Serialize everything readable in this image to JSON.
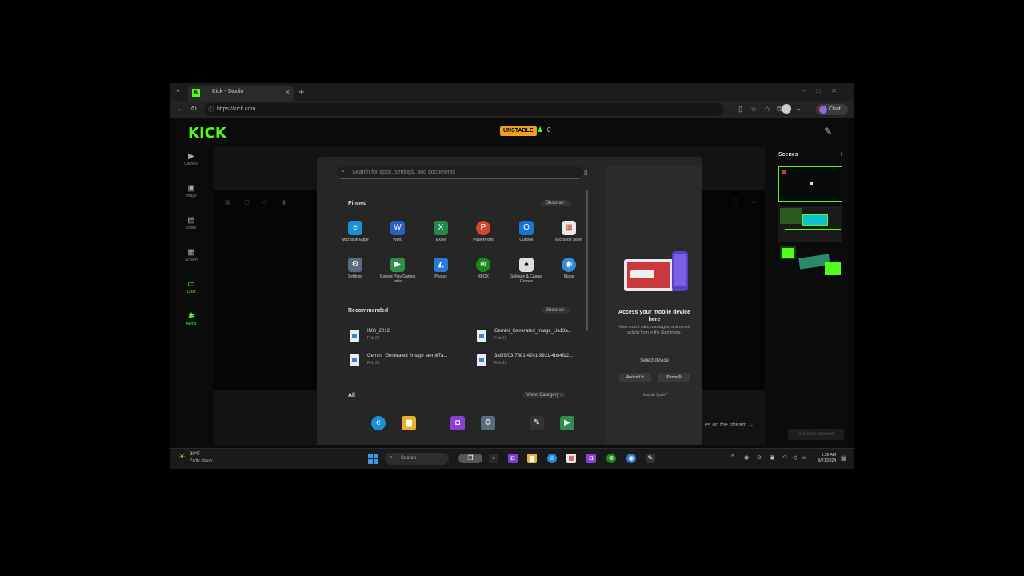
{
  "browser": {
    "tab_title": "Kick - Studio",
    "tab_favicon": "K",
    "tab_close": "×",
    "new_tab": "+",
    "tab_list": "⌄",
    "url": "https://kick.com",
    "url_lock": "ⓘ",
    "chat_label": "Chat",
    "icons": [
      "back-icon",
      "refresh-icon",
      "split-screen-icon",
      "reading-view-icon",
      "favorites-icon",
      "collections-icon",
      "profile-icon",
      "copilot-icon"
    ]
  },
  "kick": {
    "logo": "KICK",
    "brand_color": "#53fc18",
    "status_badge": "UNSTABLE",
    "status_color": "#f0a020",
    "viewer_count": "0",
    "nav": [
      {
        "label": "Camera",
        "icon": "camera-icon",
        "glyph": "▶"
      },
      {
        "label": "Image",
        "icon": "image-icon",
        "glyph": "▣"
      },
      {
        "label": "Video",
        "icon": "video-icon",
        "glyph": "▤"
      },
      {
        "label": "Screen",
        "icon": "screen-icon",
        "glyph": "▦"
      },
      {
        "label": "Chat",
        "icon": "chat-icon",
        "glyph": "▭",
        "active": true
      },
      {
        "label": "Alerts",
        "icon": "alerts-icon",
        "glyph": "✱",
        "active": true
      }
    ],
    "scenes_title": "Scenes",
    "scenes_add": "+",
    "stream_chat_hint": "es on the stream →",
    "bottom_button": "Connect account"
  },
  "start_menu": {
    "search_placeholder": "Search for apps, settings, and documents",
    "pinned_title": "Pinned",
    "show_all": "Show all  ›",
    "pinned": [
      {
        "label": "Microsoft Edge",
        "icon": "edge-icon",
        "color": "#1c8fd8",
        "glyph": "e"
      },
      {
        "label": "Word",
        "icon": "word-icon",
        "color": "#2b5fc4",
        "glyph": "W"
      },
      {
        "label": "Excel",
        "icon": "excel-icon",
        "color": "#1f8a4c",
        "glyph": "X"
      },
      {
        "label": "PowerPoint",
        "icon": "powerpoint-icon",
        "color": "#d2492a",
        "glyph": "P"
      },
      {
        "label": "Outlook",
        "icon": "outlook-icon",
        "color": "#1a74d0",
        "glyph": "O"
      },
      {
        "label": "Microsoft Store",
        "icon": "store-icon",
        "color": "#e8e8e8",
        "glyph": "▦"
      },
      {
        "label": "Settings",
        "icon": "settings-icon",
        "color": "#5a6b80",
        "glyph": "⚙"
      },
      {
        "label": "Google Play Games beta",
        "icon": "google-play-games-icon",
        "color": "#2f8f4f",
        "glyph": "▶"
      },
      {
        "label": "Photos",
        "icon": "photos-icon",
        "color": "#2a7ad8",
        "glyph": "◭"
      },
      {
        "label": "XBOX",
        "icon": "xbox-icon",
        "color": "#178a17",
        "glyph": "⊗"
      },
      {
        "label": "Solitaire & Casual Games",
        "icon": "solitaire-icon",
        "color": "#dddddd",
        "glyph": "♠"
      },
      {
        "label": "Maps",
        "icon": "maps-icon",
        "color": "#2d8fd8",
        "glyph": "◉"
      }
    ],
    "recommended_title": "Recommended",
    "recommended": [
      {
        "name": "IMG_2012",
        "date": "Feb 25"
      },
      {
        "name": "Gemini_Generated_Image_Ua13a...",
        "date": "Feb 13"
      },
      {
        "name": "Gemini_Generated_Image_aemk7a...",
        "date": "Feb 21"
      },
      {
        "name": "3a9f9f03-7681-4201-9921-4bb4fb2...",
        "date": "Feb 13"
      }
    ],
    "all_title": "All",
    "view_label": "View: Category  ›",
    "all_apps": [
      {
        "icon": "edge-icon",
        "color": "#1c8fd8",
        "glyph": "e"
      },
      {
        "icon": "file-explorer-icon",
        "color": "#e8b12a",
        "glyph": "▆"
      },
      {
        "icon": "photo-editor-icon",
        "color": "#8a3fd8",
        "glyph": "◘"
      },
      {
        "icon": "settings-icon",
        "color": "#5a6b80",
        "glyph": "⚙"
      },
      {
        "icon": "paint-icon",
        "color": "#333333",
        "glyph": "✎"
      },
      {
        "icon": "google-play-games-icon",
        "color": "#2f8f4f",
        "glyph": "▶"
      }
    ],
    "phone_panel": {
      "title": "Access your mobile device here",
      "desc": "View recent calls, messages, and recent activity from in the Start menu.",
      "select": "Select device",
      "android": "Android™",
      "iphone": "iPhone®",
      "help": "How do I pair?"
    }
  },
  "taskbar": {
    "weather_temp": "90°F",
    "weather_cond": "Partly cloudy",
    "search_label": "Search",
    "apps": [
      {
        "icon": "task-view-icon",
        "color": "#2a2a2a",
        "glyph": "❐"
      },
      {
        "icon": "photo-editor-icon",
        "color": "#7a3fd8",
        "glyph": "◘"
      },
      {
        "icon": "file-explorer-icon",
        "color": "#e8b12a",
        "glyph": "▆"
      },
      {
        "icon": "edge-icon",
        "color": "#1c8fd8",
        "glyph": "e"
      },
      {
        "icon": "store-icon",
        "color": "#e8e8e8",
        "glyph": "▦"
      },
      {
        "icon": "photos-icon",
        "color": "#8a3fd8",
        "glyph": "◘"
      },
      {
        "icon": "xbox-icon",
        "color": "#178a17",
        "glyph": "⊗"
      },
      {
        "icon": "chrome-icon",
        "color": "#2a7ad8",
        "glyph": "◉"
      },
      {
        "icon": "paint-icon",
        "color": "#333333",
        "glyph": "✎"
      }
    ],
    "time": "1:32 AM",
    "date": "6/21/2024"
  }
}
